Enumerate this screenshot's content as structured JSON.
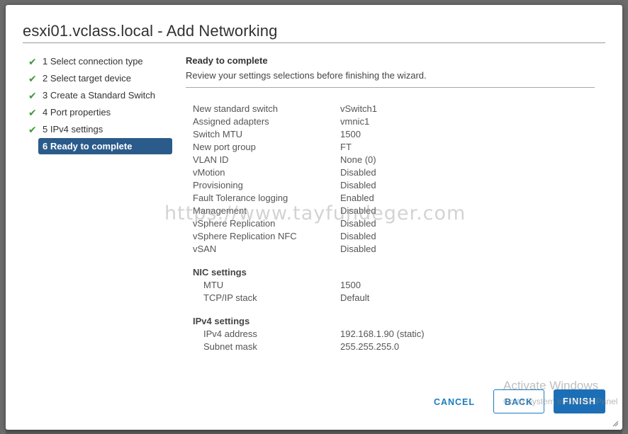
{
  "dialog": {
    "title": "esxi01.vclass.local - Add Networking"
  },
  "steps": [
    {
      "label": "1 Select connection type",
      "done": true
    },
    {
      "label": "2 Select target device",
      "done": true
    },
    {
      "label": "3 Create a Standard Switch",
      "done": true
    },
    {
      "label": "4 Port properties",
      "done": true
    },
    {
      "label": "5 IPv4 settings",
      "done": true
    },
    {
      "label": "6 Ready to complete",
      "active": true
    }
  ],
  "content": {
    "title": "Ready to complete",
    "subtitle": "Review your settings selections before finishing the wizard."
  },
  "summary": {
    "general": [
      {
        "key": "New standard switch",
        "value": "vSwitch1"
      },
      {
        "key": "Assigned adapters",
        "value": "vmnic1"
      },
      {
        "key": "Switch MTU",
        "value": "1500"
      },
      {
        "key": "New port group",
        "value": "FT"
      },
      {
        "key": "VLAN ID",
        "value": "None (0)"
      },
      {
        "key": "vMotion",
        "value": "Disabled"
      },
      {
        "key": "Provisioning",
        "value": "Disabled"
      },
      {
        "key": "Fault Tolerance logging",
        "value": "Enabled"
      },
      {
        "key": "Management",
        "value": "Disabled"
      },
      {
        "key": "vSphere Replication",
        "value": "Disabled"
      },
      {
        "key": "vSphere Replication NFC",
        "value": "Disabled"
      },
      {
        "key": "vSAN",
        "value": "Disabled"
      }
    ],
    "nic_title": "NIC settings",
    "nic": [
      {
        "key": "MTU",
        "value": "1500"
      },
      {
        "key": "TCP/IP stack",
        "value": "Default"
      }
    ],
    "ipv4_title": "IPv4 settings",
    "ipv4": [
      {
        "key": "IPv4 address",
        "value": "192.168.1.90 (static)"
      },
      {
        "key": "Subnet mask",
        "value": "255.255.255.0"
      }
    ]
  },
  "overlay": {
    "watermark": "https://www.tayfundeger.com",
    "activate_title": "Activate Windows",
    "activate_sub": "Go to System in Control Panel"
  },
  "buttons": {
    "cancel": "CANCEL",
    "back": "BACK",
    "finish": "FINISH"
  },
  "colors": {
    "active_step_bg": "#2b5b8a",
    "check": "#3d9b3d",
    "primary": "#1c6fb6",
    "link": "#1a7bc1"
  }
}
